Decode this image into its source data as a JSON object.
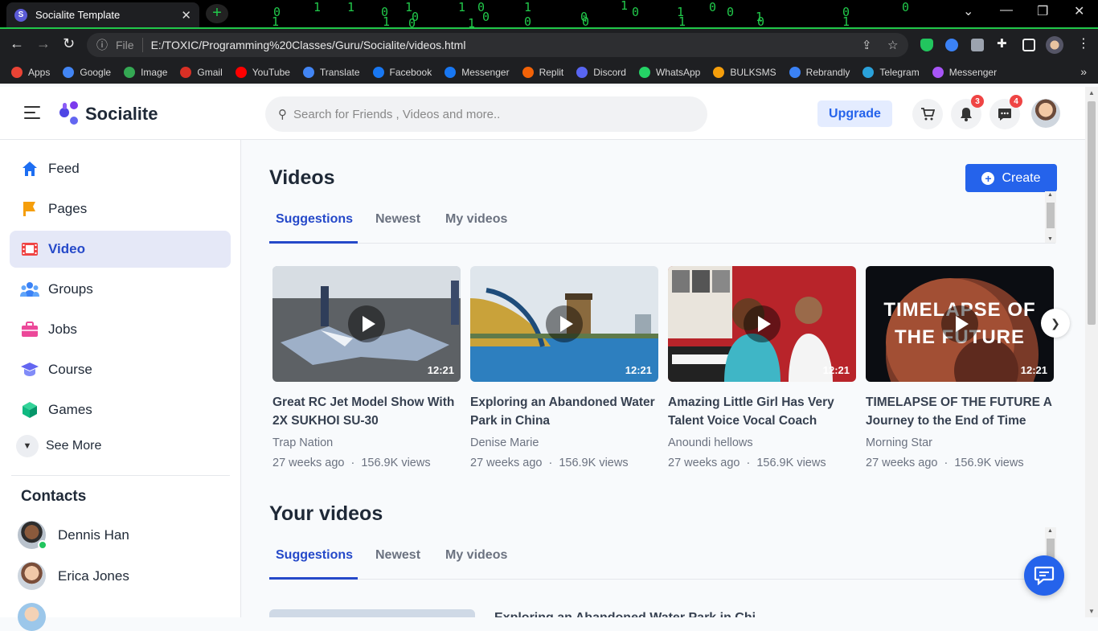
{
  "browser": {
    "tab_title": "Socialite Template",
    "tab_favicon": "S",
    "url_scheme": "File",
    "url": "E:/TOXIC/Programming%20Classes/Guru/Socialite/videos.html",
    "matrix_digits": [
      "0",
      "1",
      "1",
      "0",
      "1",
      "0",
      "1",
      "0",
      "0",
      "1",
      "0",
      "1",
      "0",
      "1",
      "0",
      "0",
      "1",
      "0",
      "0",
      "1",
      "1",
      "0",
      "1",
      "0",
      "0",
      "1",
      "0",
      "1"
    ],
    "bookmarks": [
      {
        "label": "Apps",
        "icon": "apps-grid-icon",
        "color": "#ea4335"
      },
      {
        "label": "Google",
        "icon": "google-icon",
        "color": "#4285f4"
      },
      {
        "label": "Image",
        "icon": "google-image-icon",
        "color": "#34a853"
      },
      {
        "label": "Gmail",
        "icon": "gmail-icon",
        "color": "#d93025"
      },
      {
        "label": "YouTube",
        "icon": "youtube-icon",
        "color": "#ff0000"
      },
      {
        "label": "Translate",
        "icon": "translate-icon",
        "color": "#4285f4"
      },
      {
        "label": "Facebook",
        "icon": "facebook-icon",
        "color": "#1877f2"
      },
      {
        "label": "Messenger",
        "icon": "facebook-icon",
        "color": "#1877f2"
      },
      {
        "label": "Replit",
        "icon": "replit-icon",
        "color": "#f26207"
      },
      {
        "label": "Discord",
        "icon": "discord-icon",
        "color": "#5865f2"
      },
      {
        "label": "WhatsApp",
        "icon": "whatsapp-icon",
        "color": "#25d366"
      },
      {
        "label": "BULKSMS",
        "icon": "bulksms-icon",
        "color": "#f59e0b"
      },
      {
        "label": "Rebrandly",
        "icon": "rebrandly-icon",
        "color": "#3b82f6"
      },
      {
        "label": "Telegram",
        "icon": "telegram-icon",
        "color": "#2aa1da"
      },
      {
        "label": "Messenger",
        "icon": "messenger-icon",
        "color": "#a855f7"
      }
    ]
  },
  "header": {
    "brand": "Socialite",
    "search_placeholder": "Search for Friends , Videos and more..",
    "upgrade_label": "Upgrade",
    "notifications_count": "3",
    "messages_count": "4"
  },
  "sidebar": {
    "items": [
      {
        "label": "Feed",
        "icon": "home-icon",
        "active": false
      },
      {
        "label": "Pages",
        "icon": "flag-icon",
        "active": false
      },
      {
        "label": "Video",
        "icon": "film-icon",
        "active": true
      },
      {
        "label": "Groups",
        "icon": "users-icon",
        "active": false
      },
      {
        "label": "Jobs",
        "icon": "briefcase-icon",
        "active": false
      },
      {
        "label": "Course",
        "icon": "graduation-cap-icon",
        "active": false
      },
      {
        "label": "Games",
        "icon": "cube-icon",
        "active": false
      }
    ],
    "see_more_label": "See More",
    "contacts_title": "Contacts",
    "contacts": [
      {
        "name": "Dennis Han",
        "online": true
      },
      {
        "name": "Erica Jones",
        "online": false
      }
    ]
  },
  "main": {
    "videos_title": "Videos",
    "create_label": "Create",
    "tabs": [
      "Suggestions",
      "Newest",
      "My videos"
    ],
    "cards": [
      {
        "title": "Great RC Jet Model Show With 2X SUKHOI SU-30",
        "channel": "Trap Nation",
        "age": "27 weeks ago",
        "views": "156.9K views",
        "duration": "12:21",
        "thumb_text": ""
      },
      {
        "title": "Exploring an Abandoned Water Park in China",
        "channel": "Denise Marie",
        "age": "27 weeks ago",
        "views": "156.9K views",
        "duration": "12:21",
        "thumb_text": ""
      },
      {
        "title": "Amazing Little Girl Has Very Talent Voice Vocal Coach",
        "channel": "Anoundi hellows",
        "age": "27 weeks ago",
        "views": "156.9K views",
        "duration": "12:21",
        "thumb_text": ""
      },
      {
        "title": "TIMELAPSE OF THE FUTURE A Journey to the End of Time",
        "channel": "Morning Star",
        "age": "27 weeks ago",
        "views": "156.9K views",
        "duration": "12:21",
        "thumb_text": "TIMELAPSE OF THE FUTURE"
      }
    ],
    "meta_separator": "·",
    "your_videos_title": "Your videos",
    "your_tabs": [
      "Suggestions",
      "Newest",
      "My videos"
    ],
    "peek_title": "Exploring an Abandoned Water Park in Chi"
  },
  "colors": {
    "accent": "#2563eb",
    "active_nav_bg": "#e5e8f7",
    "badge": "#ef4444",
    "online": "#22c55e",
    "matrix_green": "#21c84a"
  }
}
